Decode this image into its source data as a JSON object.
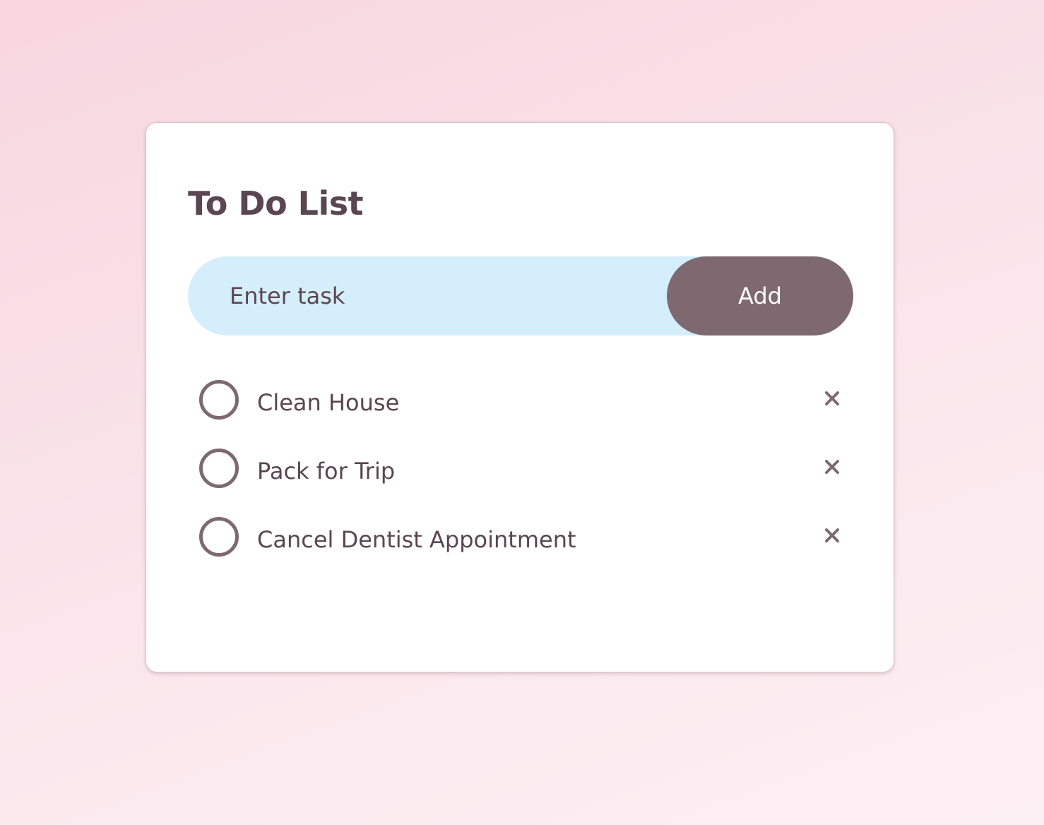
{
  "app": {
    "title": "To Do List"
  },
  "input": {
    "placeholder": "Enter task",
    "value": ""
  },
  "add_button": {
    "label": "Add"
  },
  "tasks": [
    {
      "label": "Clean House",
      "completed": false
    },
    {
      "label": "Pack for Trip",
      "completed": false
    },
    {
      "label": "Cancel Dentist Appointment",
      "completed": false
    }
  ],
  "icons": {
    "checkbox": "circle-outline-icon",
    "delete": "close-icon"
  },
  "colors": {
    "accent": "#7e6970",
    "text": "#5a464f",
    "input_bg": "#d5eefb",
    "card_bg": "#ffffff"
  }
}
